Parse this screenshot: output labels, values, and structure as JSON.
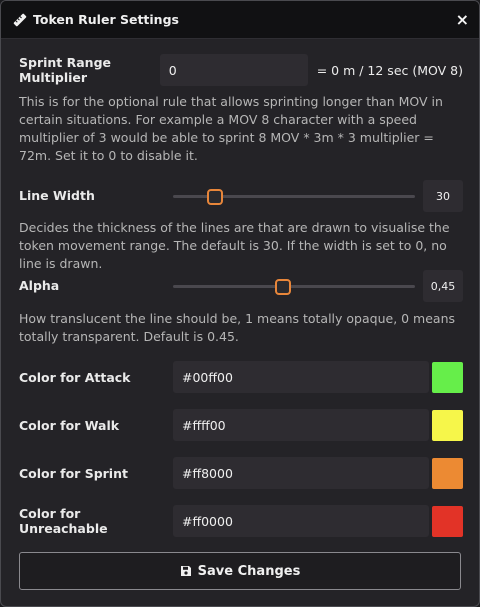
{
  "window": {
    "title": "Token Ruler Settings",
    "close_label": "×"
  },
  "sprint": {
    "label": "Sprint Range Multiplier",
    "value": "0",
    "result": "= 0 m / 12 sec (MOV 8)",
    "help": "This is for the optional rule that allows sprinting longer than MOV in certain situations. For example a MOV 8 character with a speed multiplier of 3 would be able to sprint 8 MOV * 3m * 3 multiplier = 72m. Set it to 0 to disable it."
  },
  "line_width": {
    "label": "Line Width",
    "value": "30",
    "fraction": 0.17,
    "help": "Decides the thickness of the lines are that are drawn to visualise the token movement range. The default is 30. If the width is set to 0, no line is drawn."
  },
  "alpha": {
    "label": "Alpha",
    "value": "0,45",
    "fraction": 0.45,
    "help": "How translucent the line should be, 1 means totally opaque, 0 means totally transparent. Default is 0.45."
  },
  "colors": [
    {
      "label": "Color for Attack",
      "value": "#00ff00",
      "swatch": "#66ee4a"
    },
    {
      "label": "Color for Walk",
      "value": "#ffff00",
      "swatch": "#f6f64a"
    },
    {
      "label": "Color for Sprint",
      "value": "#ff8000",
      "swatch": "#ec8a33"
    },
    {
      "label": "Color for Unreachable",
      "value": "#ff0000",
      "swatch": "#e23327"
    }
  ],
  "save_label": "Save Changes",
  "accent": "#e8863a"
}
